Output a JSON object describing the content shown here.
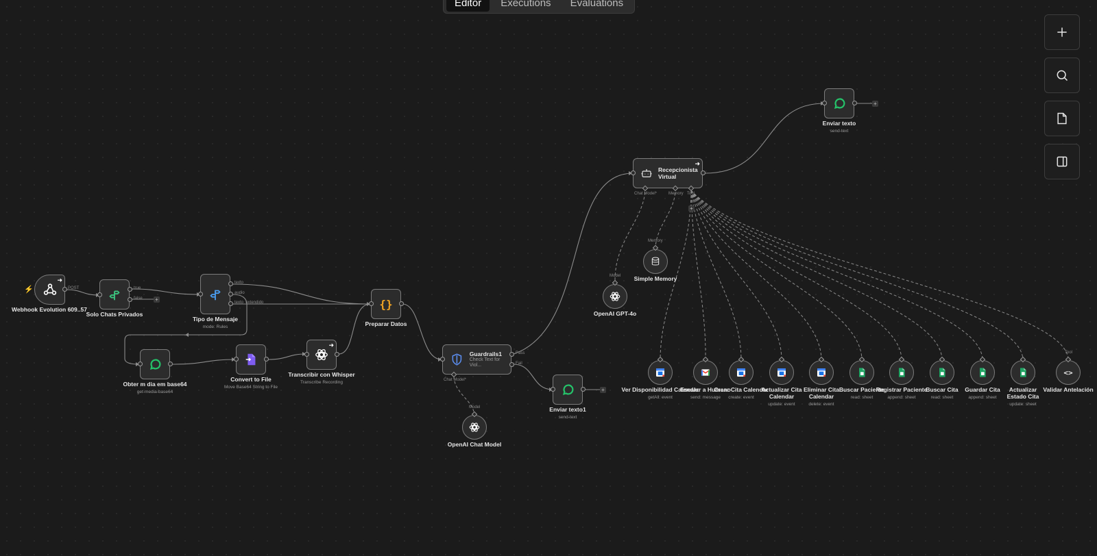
{
  "tabs": [
    "Editor",
    "Executions",
    "Evaluations"
  ],
  "active_tab": "Editor",
  "toolbar": [
    {
      "name": "zoom-in-button",
      "icon": "plus-icon"
    },
    {
      "name": "search-nodes-button",
      "icon": "search-icon"
    },
    {
      "name": "add-sticky-button",
      "icon": "sticky-note-icon"
    },
    {
      "name": "toggle-panel-button",
      "icon": "sidebar-panel-icon"
    }
  ],
  "colors": {
    "canvas": "#1b1b1b",
    "node_bg": "#2c2c2c",
    "node_border": "#7c7c7c",
    "edge": "#8c8c8c",
    "whatsapp_green": "#25c36a",
    "if_green": "#3bc47f",
    "switch_blue": "#4a9df0",
    "code_orange": "#f5a623",
    "convert_purple": "#7e5cf0",
    "guard_blue": "#5b8def",
    "sheets_green": "#1fa463",
    "trigger_bolt": "#e35b4f"
  },
  "nodes": [
    {
      "id": "webhook",
      "label": "Webhook Evolution 609..57",
      "sub": "",
      "icon": "webhook-icon"
    },
    {
      "id": "solo",
      "label": "Solo Chats Privados",
      "sub": "",
      "icon": "if-branch-icon"
    },
    {
      "id": "tipo",
      "label": "Tipo de Mensaje",
      "sub": "mode: Rules",
      "icon": "switch-icon"
    },
    {
      "id": "preparar",
      "label": "Preparar Datos",
      "sub": "",
      "icon": "code-braces-icon"
    },
    {
      "id": "obter",
      "label": "Obter m dia em base64",
      "sub": "get-media-base64",
      "icon": "whatsapp-icon"
    },
    {
      "id": "convert",
      "label": "Convert to File",
      "sub": "Move Base64 String to File",
      "icon": "file-convert-icon"
    },
    {
      "id": "whisper",
      "label": "Transcribir con Whisper",
      "sub": "Transcribe Recording",
      "icon": "openai-icon"
    },
    {
      "id": "guardrails",
      "label": "Guardrails1",
      "sub": "Check Text for Viol...",
      "icon": "shield-icon"
    },
    {
      "id": "enviar1",
      "label": "Enviar texto1",
      "sub": "send-text",
      "icon": "whatsapp-icon"
    },
    {
      "id": "chatmodel",
      "label": "OpenAI Chat Model",
      "sub": "",
      "icon": "openai-icon"
    },
    {
      "id": "recep",
      "label": "Recepcionista Virtual",
      "sub": "",
      "icon": "robot-icon"
    },
    {
      "id": "enviar",
      "label": "Enviar texto",
      "sub": "send-text",
      "icon": "whatsapp-icon"
    },
    {
      "id": "gpt4o",
      "label": "OpenAI GPT-4o",
      "sub": "",
      "icon": "openai-icon"
    },
    {
      "id": "memory",
      "label": "Simple Memory",
      "sub": "",
      "icon": "database-icon"
    },
    {
      "id": "t1",
      "label": "Ver Disponibilidad Calendar",
      "sub": "getAll: event",
      "icon": "google-calendar-icon"
    },
    {
      "id": "t2",
      "label": "Escalar a Humano",
      "sub": "send: message",
      "icon": "gmail-icon"
    },
    {
      "id": "t3",
      "label": "Crear Cita Calendar",
      "sub": "create: event",
      "icon": "google-calendar-icon"
    },
    {
      "id": "t4",
      "label": "Actualizar Cita Calendar",
      "sub": "update: event",
      "icon": "google-calendar-icon"
    },
    {
      "id": "t5",
      "label": "Eliminar Cita Calendar",
      "sub": "delete: event",
      "icon": "google-calendar-icon"
    },
    {
      "id": "t6",
      "label": "Buscar Paciente",
      "sub": "read: sheet",
      "icon": "google-sheets-icon"
    },
    {
      "id": "t7",
      "label": "Registrar Paciente",
      "sub": "append: sheet",
      "icon": "google-sheets-icon"
    },
    {
      "id": "t8",
      "label": "Buscar Cita",
      "sub": "read: sheet",
      "icon": "google-sheets-icon"
    },
    {
      "id": "t9",
      "label": "Guardar Cita",
      "sub": "append: sheet",
      "icon": "google-sheets-icon"
    },
    {
      "id": "t10",
      "label": "Actualizar Estado Cita",
      "sub": "update: sheet",
      "icon": "google-sheets-icon"
    },
    {
      "id": "t11",
      "label": "Validar Antelación",
      "sub": "",
      "icon": "code-icon"
    }
  ],
  "port_labels": {
    "post": "POST",
    "true": "true",
    "false": "false",
    "texto": "texto",
    "audio": "audio",
    "texto_extendido": "texto_extendido",
    "pass": "Pass",
    "fail": "Fail",
    "chat_model_req": "Chat Model*",
    "chat_model": "Chat Model*",
    "memory": "Memory",
    "tool": "Tool",
    "model": "Model",
    "model2": "Model",
    "memory_top": "Memory",
    "tool_top": "Tool"
  }
}
